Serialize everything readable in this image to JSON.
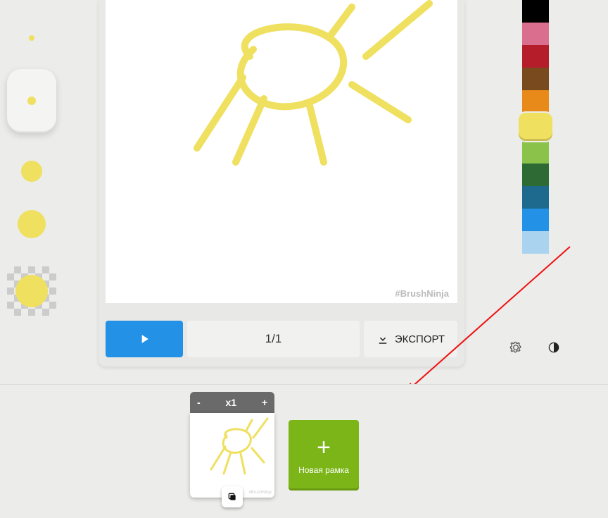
{
  "watermark": "#BrushNinja",
  "toolbar": {
    "frame_counter": "1/1",
    "export_label": "ЭКСПОРТ"
  },
  "palette": {
    "colors": [
      "#000000",
      "#da6e8f",
      "#b51d2a",
      "#7a4a1f",
      "#e88a1a",
      "#efe060",
      "#8bc34a",
      "#2e6b34",
      "#1e6a8e",
      "#2291e6",
      "#a9d3ef"
    ],
    "selected_index": 5
  },
  "timeline": {
    "speed_label": "x1",
    "minus_label": "-",
    "plus_label": "+",
    "new_frame_label": "Новая рамка",
    "plus_icon": "+"
  }
}
